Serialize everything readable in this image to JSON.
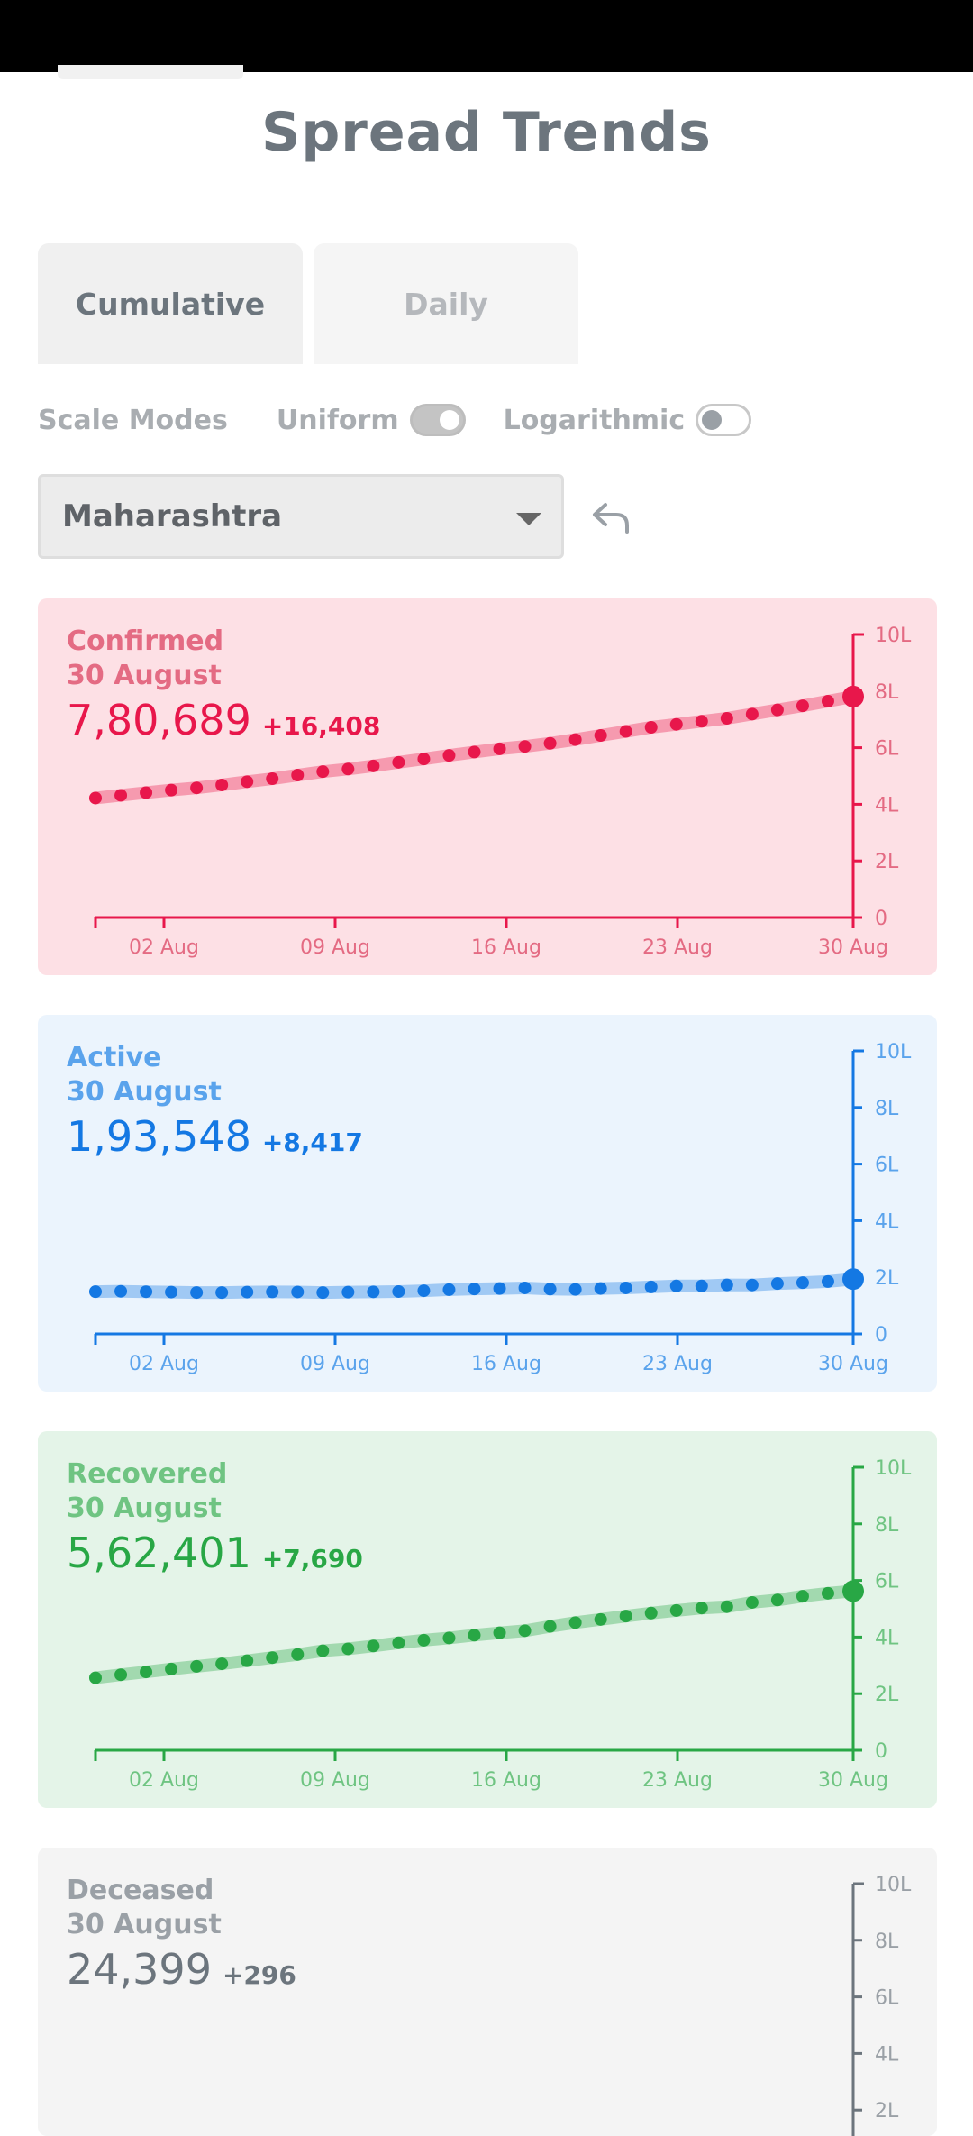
{
  "page": {
    "title": "Spread Trends"
  },
  "tabs": [
    {
      "label": "Cumulative",
      "active": true
    },
    {
      "label": "Daily",
      "active": false
    }
  ],
  "scale": {
    "label": "Scale Modes",
    "uniform": {
      "label": "Uniform",
      "on": true
    },
    "logarithmic": {
      "label": "Logarithmic",
      "on": false
    }
  },
  "region_select": {
    "value": "Maharashtra"
  },
  "chart_data": [
    {
      "type": "line",
      "title": "Confirmed",
      "date": "30 August",
      "value": "7,80,689",
      "delta": "+16,408",
      "color": "#e8174b",
      "background": "#fde0e5",
      "light_color": "#e46b83",
      "x": [
        "31 Jul",
        "01 Aug",
        "02 Aug",
        "03 Aug",
        "04 Aug",
        "05 Aug",
        "06 Aug",
        "07 Aug",
        "08 Aug",
        "09 Aug",
        "10 Aug",
        "11 Aug",
        "12 Aug",
        "13 Aug",
        "14 Aug",
        "15 Aug",
        "16 Aug",
        "17 Aug",
        "18 Aug",
        "19 Aug",
        "20 Aug",
        "21 Aug",
        "22 Aug",
        "23 Aug",
        "24 Aug",
        "25 Aug",
        "26 Aug",
        "27 Aug",
        "28 Aug",
        "29 Aug",
        "30 Aug"
      ],
      "values": [
        422118,
        431719,
        441228,
        450196,
        457956,
        468265,
        479779,
        490262,
        503084,
        515332,
        524513,
        535601,
        548313,
        560126,
        572734,
        584754,
        595865,
        604358,
        615477,
        628642,
        643289,
        657450,
        671942,
        682383,
        693398,
        703823,
        718711,
        733568,
        747995,
        764281,
        780689
      ],
      "ylim": [
        0,
        1000000
      ],
      "yticks": [
        "0",
        "2L",
        "4L",
        "6L",
        "8L",
        "10L"
      ],
      "xticks": [
        "02 Aug",
        "09 Aug",
        "16 Aug",
        "23 Aug",
        "30 Aug"
      ]
    },
    {
      "type": "line",
      "title": "Active",
      "date": "30 August",
      "value": "1,93,548",
      "delta": "+8,417",
      "color": "#1478e3",
      "background": "#ebf4fd",
      "light_color": "#5aa3ec",
      "x": [
        "31 Jul",
        "01 Aug",
        "02 Aug",
        "03 Aug",
        "04 Aug",
        "05 Aug",
        "06 Aug",
        "07 Aug",
        "08 Aug",
        "09 Aug",
        "10 Aug",
        "11 Aug",
        "12 Aug",
        "13 Aug",
        "14 Aug",
        "15 Aug",
        "16 Aug",
        "17 Aug",
        "18 Aug",
        "19 Aug",
        "20 Aug",
        "21 Aug",
        "22 Aug",
        "23 Aug",
        "24 Aug",
        "25 Aug",
        "26 Aug",
        "27 Aug",
        "28 Aug",
        "29 Aug",
        "30 Aug"
      ],
      "values": [
        149214,
        150662,
        149007,
        147735,
        146268,
        146129,
        147820,
        148454,
        148150,
        145961,
        147513,
        148553,
        149798,
        152613,
        156409,
        158705,
        160413,
        162491,
        158395,
        157274,
        160484,
        162491,
        165921,
        169516,
        169543,
        173195,
        172873,
        177794,
        181050,
        185131,
        193548
      ],
      "ylim": [
        0,
        1000000
      ],
      "yticks": [
        "0",
        "2L",
        "4L",
        "6L",
        "8L",
        "10L"
      ],
      "xticks": [
        "02 Aug",
        "09 Aug",
        "16 Aug",
        "23 Aug",
        "30 Aug"
      ]
    },
    {
      "type": "line",
      "title": "Recovered",
      "date": "30 August",
      "value": "5,62,401",
      "delta": "+7,690",
      "color": "#28a745",
      "background": "#e4f4e8",
      "light_color": "#6fc482",
      "x": [
        "31 Jul",
        "01 Aug",
        "02 Aug",
        "03 Aug",
        "04 Aug",
        "05 Aug",
        "06 Aug",
        "07 Aug",
        "08 Aug",
        "09 Aug",
        "10 Aug",
        "11 Aug",
        "12 Aug",
        "13 Aug",
        "14 Aug",
        "15 Aug",
        "16 Aug",
        "17 Aug",
        "18 Aug",
        "19 Aug",
        "20 Aug",
        "21 Aug",
        "22 Aug",
        "23 Aug",
        "24 Aug",
        "25 Aug",
        "26 Aug",
        "27 Aug",
        "28 Aug",
        "29 Aug",
        "30 Aug"
      ],
      "values": [
        256158,
        266883,
        276809,
        287030,
        296421,
        305521,
        316375,
        327281,
        338362,
        351710,
        358421,
        368435,
        379645,
        388917,
        396755,
        406653,
        415012,
        422465,
        437556,
        451147,
        462255,
        474104,
        484753,
        494010,
        502490,
        507218,
        522411,
        530968,
        544261,
        554711,
        562401
      ],
      "ylim": [
        0,
        1000000
      ],
      "yticks": [
        "0",
        "2L",
        "4L",
        "6L",
        "8L",
        "10L"
      ],
      "xticks": [
        "02 Aug",
        "09 Aug",
        "16 Aug",
        "23 Aug",
        "30 Aug"
      ]
    },
    {
      "type": "line",
      "title": "Deceased",
      "date": "30 August",
      "value": "24,399",
      "delta": "+296",
      "color": "#6c757d",
      "background": "#f4f4f4",
      "light_color": "#9aa0a6",
      "ylim": [
        0,
        1000000
      ],
      "yticks": [
        "0",
        "2L",
        "4L",
        "6L",
        "8L",
        "10L"
      ]
    }
  ]
}
